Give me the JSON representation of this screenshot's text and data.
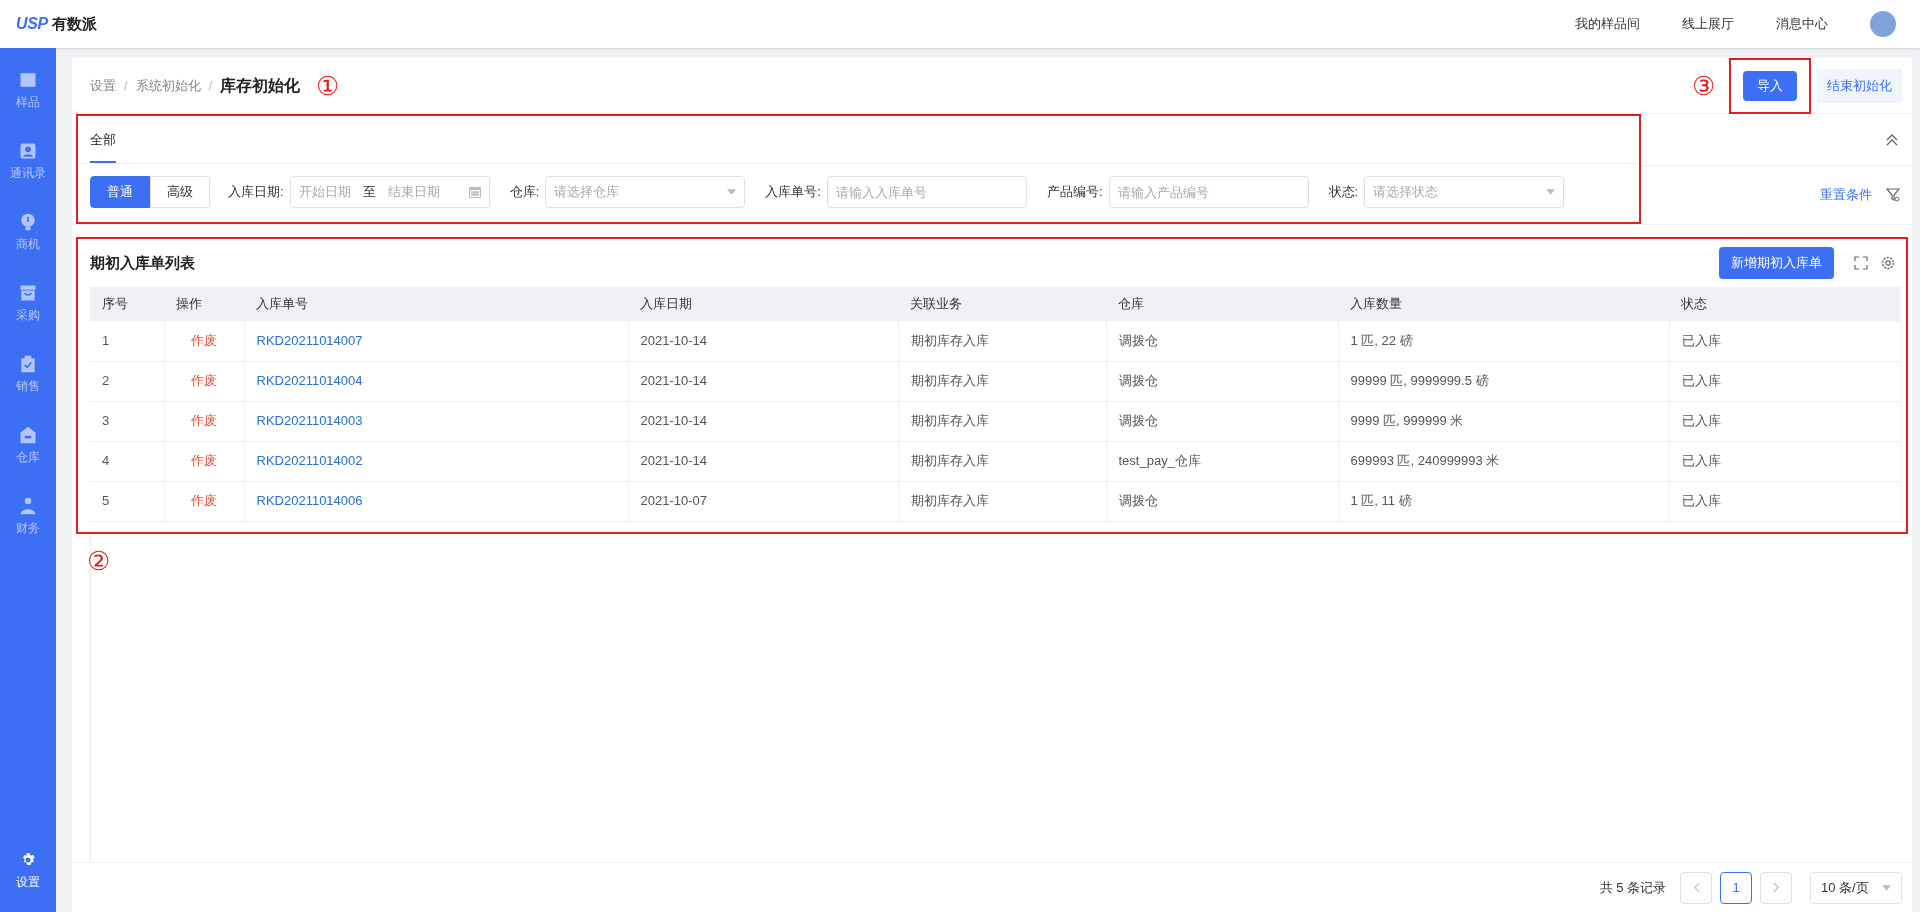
{
  "header": {
    "logo_mark": "USP",
    "logo_text": "有数派",
    "links": [
      "我的样品间",
      "线上展厅",
      "消息中心"
    ]
  },
  "sidebar": {
    "items": [
      {
        "label": "样品",
        "selected": false
      },
      {
        "label": "通讯录",
        "selected": false
      },
      {
        "label": "商机",
        "selected": false
      },
      {
        "label": "采购",
        "selected": false
      },
      {
        "label": "销售",
        "selected": false
      },
      {
        "label": "仓库",
        "selected": false
      },
      {
        "label": "财务",
        "selected": false
      }
    ],
    "footer_item": {
      "label": "设置",
      "selected": true
    }
  },
  "breadcrumb": {
    "items": [
      "设置",
      "系统初始化",
      "库存初始化"
    ],
    "separators": [
      "/",
      "/"
    ],
    "annotation": "①"
  },
  "actions": {
    "annotation": "③",
    "highlighted": true,
    "buttons": [
      {
        "label": "导入",
        "kind": "primary"
      },
      {
        "label": "结束初始化",
        "kind": "secondary"
      }
    ]
  },
  "filter_panel": {
    "highlighted": true,
    "tabs": [
      {
        "label": "全部",
        "selected": true
      }
    ],
    "mode_toggle": [
      {
        "label": "普通",
        "selected": true
      },
      {
        "label": "高级",
        "selected": false
      }
    ],
    "fields": [
      {
        "kind": "daterange",
        "label": "入库日期:",
        "start_placeholder": "开始日期",
        "separator": "至",
        "end_placeholder": "结束日期"
      },
      {
        "kind": "select",
        "label": "仓库:",
        "placeholder": "请选择仓库"
      },
      {
        "kind": "text",
        "label": "入库单号:",
        "placeholder": "请输入入库单号"
      },
      {
        "kind": "text",
        "label": "产品编号:",
        "placeholder": "请输入产品编号"
      },
      {
        "kind": "select",
        "label": "状态:",
        "placeholder": "请选择状态"
      }
    ],
    "reset": "重置条件"
  },
  "list_panel": {
    "highlighted": true,
    "title": "期初入库单列表",
    "add_button": "新增期初入库单",
    "columns": [
      {
        "label": "序号",
        "kind": "text"
      },
      {
        "label": "操作",
        "kind": "danger"
      },
      {
        "label": "入库单号",
        "kind": "link"
      },
      {
        "label": "入库日期",
        "kind": "text"
      },
      {
        "label": "关联业务",
        "kind": "text"
      },
      {
        "label": "仓库",
        "kind": "text"
      },
      {
        "label": "入库数量",
        "kind": "text"
      },
      {
        "label": "状态",
        "kind": "text"
      }
    ],
    "rows": [
      [
        "1",
        "作废",
        "RKD20211014007",
        "2021-10-14",
        "期初库存入库",
        "调拨仓",
        "1 匹, 22 磅",
        "已入库"
      ],
      [
        "2",
        "作废",
        "RKD20211014004",
        "2021-10-14",
        "期初库存入库",
        "调拨仓",
        "99999 匹, 9999999.5 磅",
        "已入库"
      ],
      [
        "3",
        "作废",
        "RKD20211014003",
        "2021-10-14",
        "期初库存入库",
        "调拨仓",
        "9999 匹, 999999 米",
        "已入库"
      ],
      [
        "4",
        "作废",
        "RKD20211014002",
        "2021-10-14",
        "期初库存入库",
        "test_pay_仓库",
        "699993 匹, 240999993 米",
        "已入库"
      ],
      [
        "5",
        "作废",
        "RKD20211014006",
        "2021-10-07",
        "期初库存入库",
        "调拨仓",
        "1 匹, 11 磅",
        "已入库"
      ]
    ],
    "annotation": "②"
  },
  "pagination": {
    "summary": "共 5 条记录",
    "pages": [
      {
        "label": "1",
        "selected": true
      }
    ],
    "page_size": "10 条/页"
  }
}
